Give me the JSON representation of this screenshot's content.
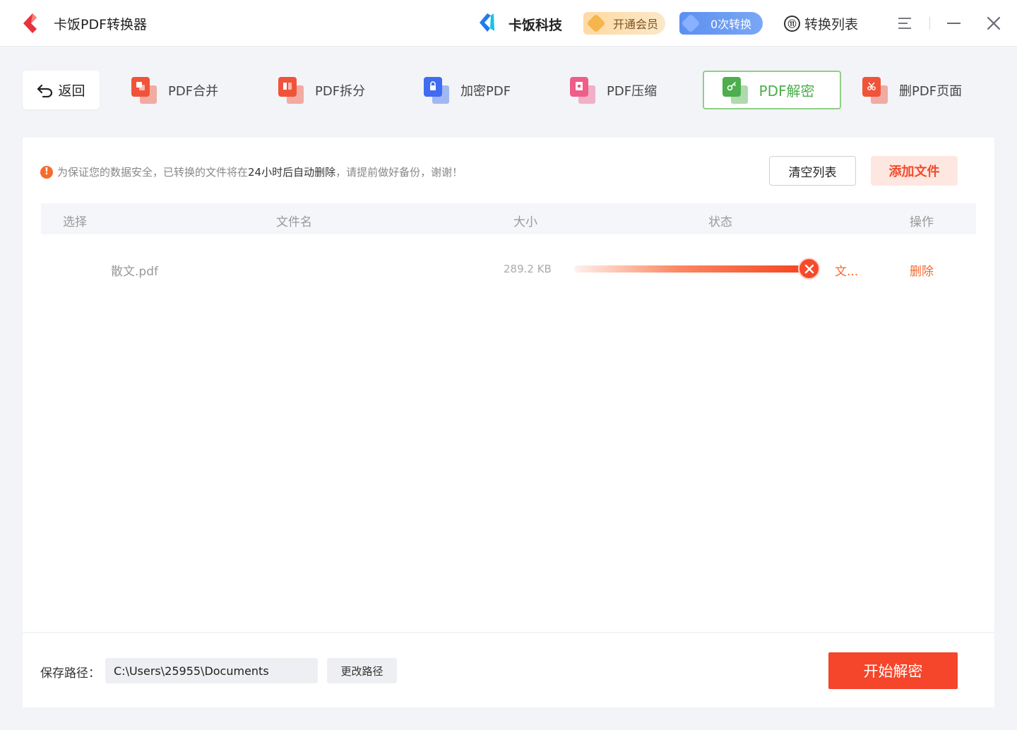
{
  "titlebar": {
    "app_title": "卡饭PDF转换器",
    "brand_name": "卡饭科技",
    "vip_label": "开通会员",
    "count_label": "0次转换",
    "list_icon_text": "⑪",
    "list_label": "转换列表"
  },
  "tools": {
    "back_label": "返回",
    "merge_label": "PDF合并",
    "split_label": "PDF拆分",
    "encrypt_label": "加密PDF",
    "compress_label": "PDF压缩",
    "decrypt_label": "PDF解密",
    "delete_pages_label": "删PDF页面",
    "colors": {
      "merge": "#f0533a",
      "split": "#f0533a",
      "encrypt": "#3f6cf0",
      "compress": "#ee5e88",
      "decrypt": "#4cae4c",
      "delete_pages": "#f0533a"
    }
  },
  "panel": {
    "notice_part1": "为保证您的数据安全，已转换的文件将在",
    "notice_em": "24小时后自动删除",
    "notice_part2": "，请提前做好备份，谢谢！",
    "clear_label": "清空列表",
    "add_label": "添加文件",
    "columns": {
      "select": "选择",
      "filename": "文件名",
      "size": "大小",
      "status": "状态",
      "action": "操作"
    },
    "files": [
      {
        "name": "散文.pdf",
        "size": "289.2 KB",
        "progress": 1.0,
        "status": "文...",
        "action": "删除"
      }
    ]
  },
  "bottom": {
    "path_label": "保存路径：",
    "path_value": "C:\\Users\\25955\\Documents",
    "change_label": "更改路径",
    "start_label": "开始解密"
  },
  "accent_color": "#f5452a"
}
